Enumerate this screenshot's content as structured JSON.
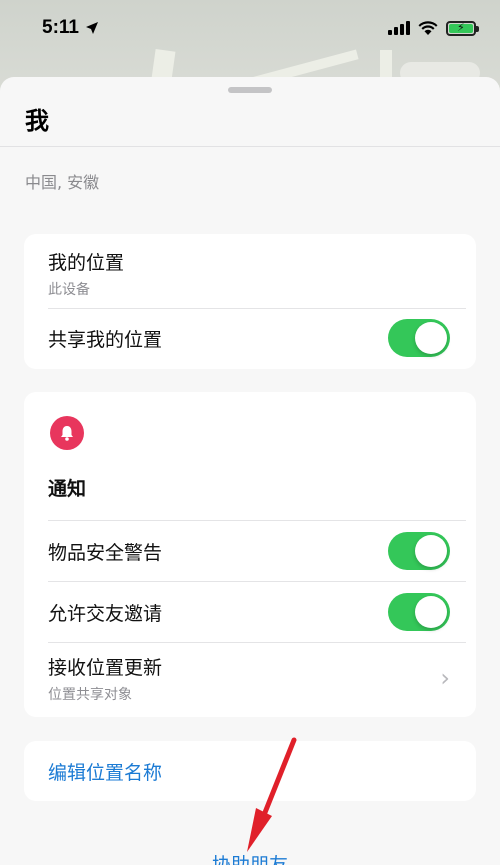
{
  "status_bar": {
    "time": "5:11"
  },
  "sheet": {
    "title": "我",
    "location": "中国, 安徽"
  },
  "location_card": {
    "my_location_title": "我的位置",
    "my_location_sub": "此设备",
    "share_location_label": "共享我的位置",
    "share_location_on": true
  },
  "notifications_card": {
    "icon": "bell-icon",
    "title": "通知",
    "item_safety_alert_label": "物品安全警告",
    "item_safety_alert_on": true,
    "item_friend_invite_label": "允许交友邀请",
    "item_friend_invite_on": true,
    "item_location_updates_label": "接收位置更新",
    "item_location_updates_sub": "位置共享对象"
  },
  "edit_card": {
    "edit_location_name_label": "编辑位置名称"
  },
  "bottom_link_label": "协助朋友",
  "colors": {
    "toggle_on": "#34c759",
    "link": "#1c7bd4",
    "bell_badge": "#e8365d",
    "annotation_arrow": "#e0202a"
  }
}
